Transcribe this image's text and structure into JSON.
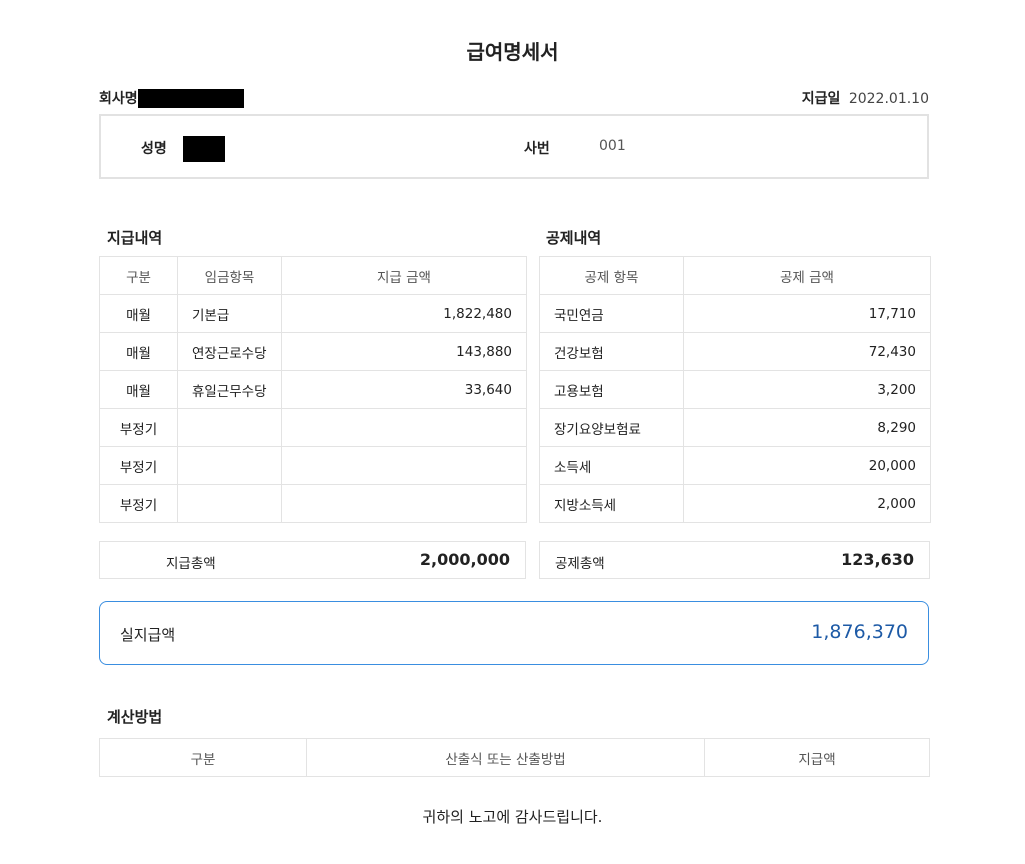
{
  "title": "급여명세서",
  "company_label": "회사명",
  "pay_date_label": "지급일",
  "pay_date": "2022.01.10",
  "employee": {
    "name_label": "성명",
    "id_label": "사번",
    "id_value": "001"
  },
  "payments": {
    "section_title": "지급내역",
    "headers": [
      "구분",
      "임금항목",
      "지급 금액"
    ],
    "rows": [
      {
        "type": "매월",
        "item": "기본급",
        "amount": "1,822,480"
      },
      {
        "type": "매월",
        "item": "연장근로수당",
        "amount": "143,880"
      },
      {
        "type": "매월",
        "item": "휴일근무수당",
        "amount": "33,640"
      },
      {
        "type": "부정기",
        "item": "",
        "amount": ""
      },
      {
        "type": "부정기",
        "item": "",
        "amount": ""
      },
      {
        "type": "부정기",
        "item": "",
        "amount": ""
      }
    ],
    "total_label": "지급총액",
    "total": "2,000,000"
  },
  "deductions": {
    "section_title": "공제내역",
    "headers": [
      "공제 항목",
      "공제 금액"
    ],
    "rows": [
      {
        "item": "국민연금",
        "amount": "17,710"
      },
      {
        "item": "건강보험",
        "amount": "72,430"
      },
      {
        "item": "고용보험",
        "amount": "3,200"
      },
      {
        "item": "장기요양보험료",
        "amount": "8,290"
      },
      {
        "item": "소득세",
        "amount": "20,000"
      },
      {
        "item": "지방소득세",
        "amount": "2,000"
      }
    ],
    "total_label": "공제총액",
    "total": "123,630"
  },
  "net_pay": {
    "label": "실지급액",
    "amount": "1,876,370"
  },
  "calculation": {
    "section_title": "계산방법",
    "headers": [
      "구분",
      "산출식 또는 산출방법",
      "지급액"
    ]
  },
  "footer": "귀하의 노고에 감사드립니다.",
  "colors": {
    "accent_border": "#3a8ee0",
    "net_amount": "#1d5aa6",
    "redaction": "#000000"
  }
}
